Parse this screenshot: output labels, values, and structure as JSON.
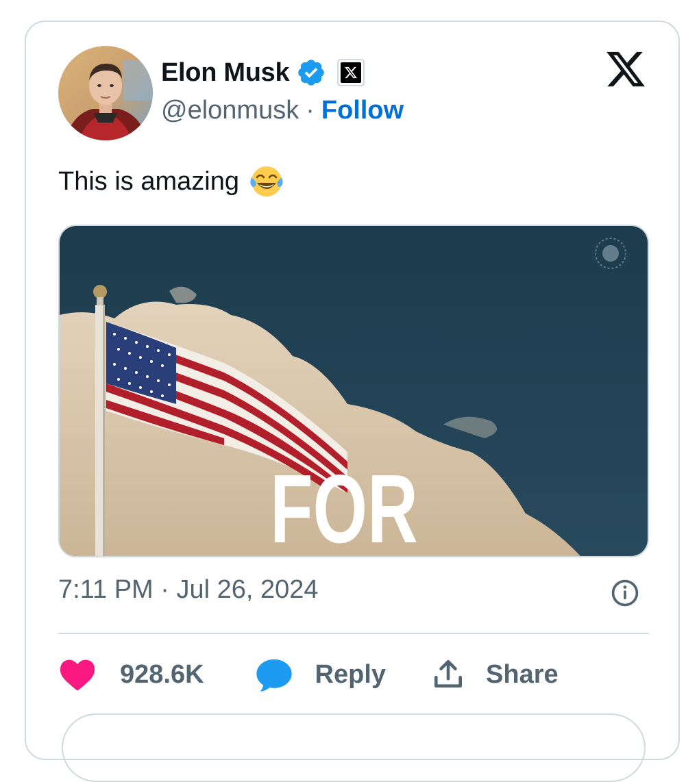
{
  "author": {
    "name": "Elon Musk",
    "handle": "@elonmusk",
    "separator": "·",
    "follow_label": "Follow",
    "verified_badge_color": "#1d9bf0"
  },
  "tweet": {
    "text": "This is amazing",
    "emoji": "face-with-tears-of-joy",
    "media_overlay_text": "FOR",
    "timestamp": "7:11 PM · Jul 26, 2024"
  },
  "actions": {
    "likes_count": "928.6K",
    "reply_label": "Reply",
    "share_label": "Share"
  },
  "colors": {
    "like": "#f91880",
    "reply": "#1d9bf0",
    "link": "#006fd6",
    "muted": "#536471",
    "border": "#cfd9de"
  },
  "icons": [
    "x-logo-icon",
    "verified-badge-icon",
    "x-affiliate-badge-icon",
    "info-icon",
    "heart-icon",
    "reply-bubble-icon",
    "share-icon"
  ]
}
